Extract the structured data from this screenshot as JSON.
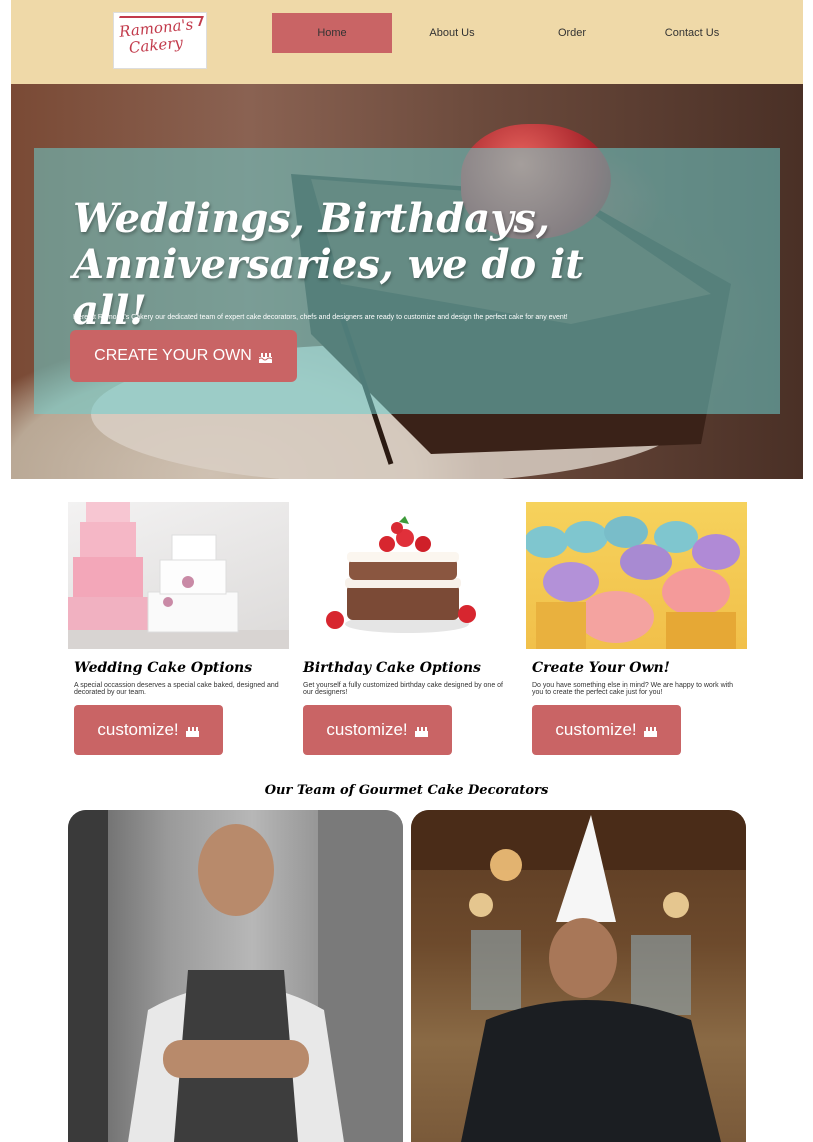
{
  "header": {
    "logo_alt": "Ramona's Cakery",
    "logo_line1": "Ramona's",
    "logo_line2": "Cakery"
  },
  "nav": {
    "items": [
      {
        "label": "Home",
        "active": true
      },
      {
        "label": "About Us",
        "active": false
      },
      {
        "label": "Order",
        "active": false
      },
      {
        "label": "Contact Us",
        "active": false
      }
    ]
  },
  "hero": {
    "title_line1": "Weddings, Birthdays,",
    "title_line2": "Anniversaries, we do it all!",
    "subtitle": "Here at Ramona's Cakery our dedicated team of expert cake decorators, chefs and designers are ready to customize and design the perfect cake for any event!",
    "cta_label": "CREATE YOUR OWN"
  },
  "cards": [
    {
      "title": "Wedding Cake Options",
      "description": "A special occassion deserves a special cake baked, designed and decorated by our team.",
      "button_label": "customize!"
    },
    {
      "title": "Birthday Cake Options",
      "description": "Get yourself a fully customized birthday cake designed by one of our designers!",
      "button_label": "customize!"
    },
    {
      "title": "Create Your Own!",
      "description": "Do you have something else in mind? We are happy to work with you to create the perfect cake just for you!",
      "button_label": "customize!"
    }
  ],
  "team": {
    "heading": "Our Team of Gourmet Cake Decorators"
  },
  "colors": {
    "header_bg": "#efd9a8",
    "accent": "#c96465",
    "hero_overlay": "rgba(110,205,205,0.55)"
  },
  "icons": {
    "cta": "birthday-cake-icon"
  }
}
